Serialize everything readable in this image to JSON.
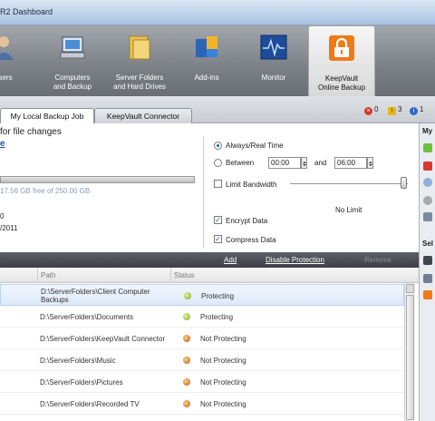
{
  "window": {
    "title": "R2 Dashboard"
  },
  "toolbar": {
    "items": [
      {
        "label": "sers",
        "icon": "users-icon"
      },
      {
        "label": "Computers\nand Backup",
        "icon": "computer-icon"
      },
      {
        "label": "Server Folders\nand Hard Drives",
        "icon": "folder-icon"
      },
      {
        "label": "Add-ins",
        "icon": "puzzle-icon"
      },
      {
        "label": "Monitor",
        "icon": "monitor-icon"
      },
      {
        "label": "KeepVault\nOnline Backup",
        "icon": "lock-icon",
        "selected": true
      }
    ]
  },
  "tabs": [
    {
      "label": "My Local Backup Job",
      "active": true
    },
    {
      "label": "KeepVault Connector",
      "active": false
    }
  ],
  "alerts": {
    "critical": "0",
    "warning": "3",
    "info": "1"
  },
  "settings": {
    "heading": "for file changes",
    "link_fragment": "e",
    "storage_text": "17.56 GB free of 250.00 GB",
    "frag_date": "0",
    "frag_year": "/2011",
    "always_label": "Always/Real Time",
    "between_label": "Between",
    "time_from": "00:00",
    "and_label": "and",
    "time_to": "06:00",
    "limit_label": "Limit Bandwidth",
    "no_limit": "No Limit",
    "encrypt_label": "Encrypt Data",
    "compress_label": "Compress Data"
  },
  "right_panel": {
    "header": "My",
    "sub_header": "Sel"
  },
  "actions": {
    "add": "Add",
    "disable": "Disable Protection",
    "remove": "Remove"
  },
  "grid": {
    "columns": [
      "Path",
      "Status"
    ],
    "rows": [
      {
        "path": "D:\\ServerFolders\\Client Computer\nBackups",
        "status": "Protecting",
        "ok": true,
        "selected": true
      },
      {
        "path": "D:\\ServerFolders\\Documents",
        "status": "Protecting",
        "ok": true
      },
      {
        "path": "D:\\ServerFolders\\KeepVault Connector",
        "status": "Not Protecting",
        "ok": false
      },
      {
        "path": "D:\\ServerFolders\\Music",
        "status": "Not Protecting",
        "ok": false
      },
      {
        "path": "D:\\ServerFolders\\Pictures",
        "status": "Not Protecting",
        "ok": false
      },
      {
        "path": "D:\\ServerFolders\\Recorded TV",
        "status": "Not Protecting",
        "ok": false
      }
    ]
  },
  "colors": {
    "accent": "#2a55a8",
    "toolbar_bg": "#7b7f86",
    "link": "#1d4fa8"
  }
}
